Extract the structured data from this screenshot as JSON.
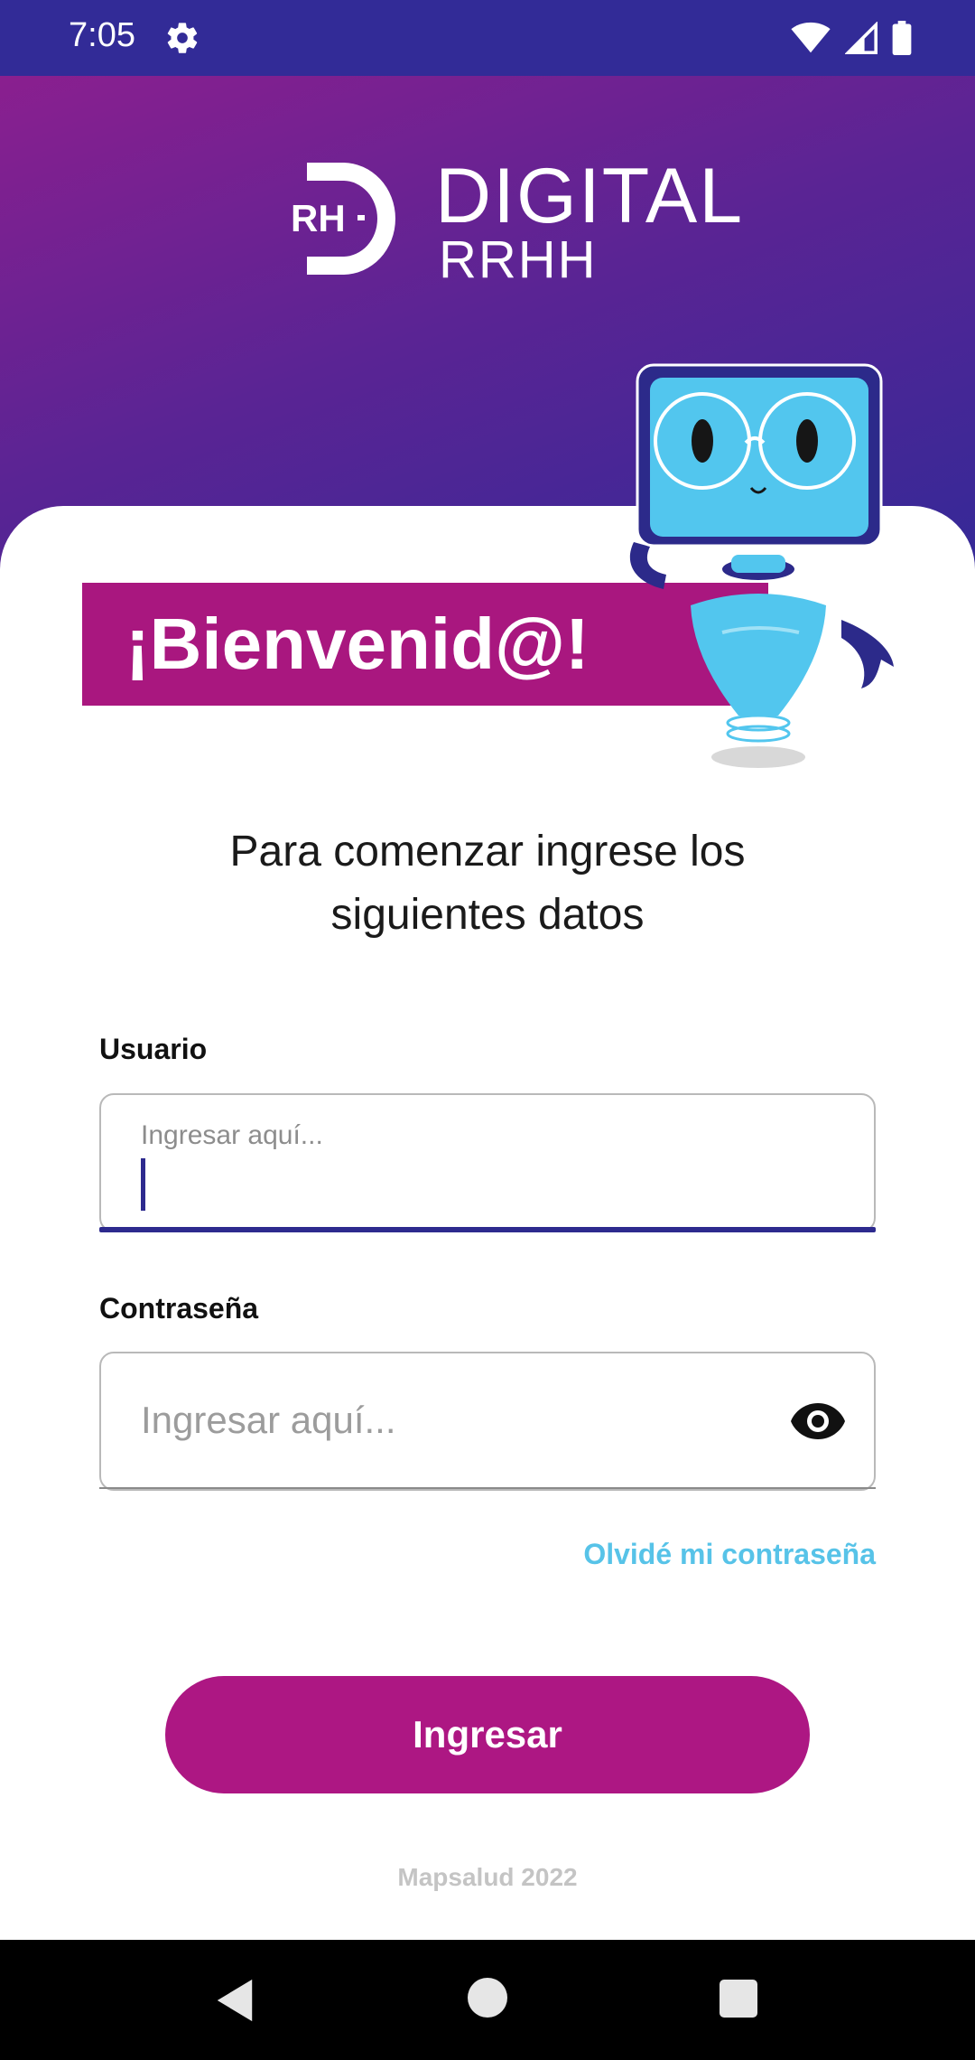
{
  "status_bar": {
    "time": "7:05",
    "icons": [
      "gear-icon",
      "wifi-icon",
      "signal-icon",
      "battery-icon"
    ]
  },
  "logo": {
    "mark_text": "RH",
    "line1": "DIGITAL",
    "line2": "RRHH"
  },
  "welcome": "¡Bienvenid@!",
  "intro": "Para comenzar ingrese los siguientes datos",
  "form": {
    "user_label": "Usuario",
    "user_placeholder": "Ingresar aquí...",
    "password_label": "Contraseña",
    "password_placeholder": "Ingresar aquí...",
    "toggle_visibility_icon": "eye-icon"
  },
  "forgot_password": "Olvidé mi contraseña",
  "submit_label": "Ingresar",
  "footer": "Mapsalud 2022",
  "colors": {
    "status_bar": "#322b97",
    "brand_magenta": "#ad1783",
    "brand_purple": "#2f2a98",
    "link_cyan": "#57c3e8"
  },
  "nav": [
    "back-icon",
    "home-icon",
    "recents-icon"
  ]
}
